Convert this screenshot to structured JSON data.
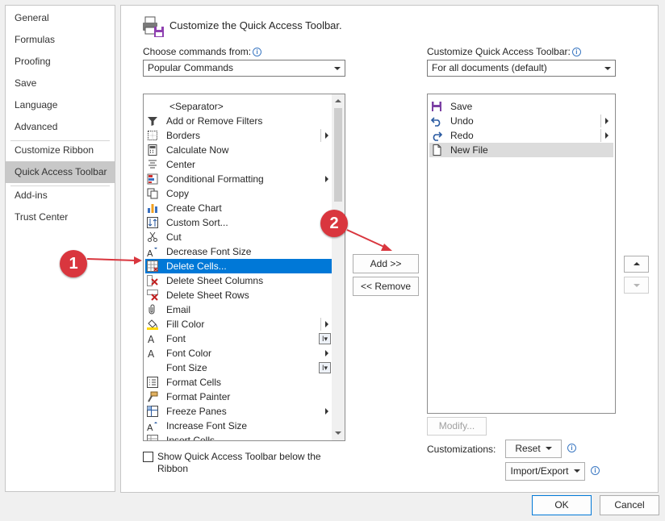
{
  "nav": {
    "items": [
      "General",
      "Formulas",
      "Proofing",
      "Save",
      "Language",
      "Advanced",
      "Customize Ribbon",
      "Quick Access Toolbar",
      "Add-ins",
      "Trust Center"
    ],
    "selected": "Quick Access Toolbar"
  },
  "header": {
    "title": "Customize the Quick Access Toolbar."
  },
  "left": {
    "label": "Choose commands from:",
    "source_value": "Popular Commands",
    "commands": [
      {
        "label": "<Separator>",
        "icon": "separator"
      },
      {
        "label": "Add or Remove Filters",
        "icon": "filter-icon"
      },
      {
        "label": "Borders",
        "icon": "borders-icon",
        "submenu": "box"
      },
      {
        "label": "Calculate Now",
        "icon": "calculator-icon"
      },
      {
        "label": "Center",
        "icon": "center-align-icon"
      },
      {
        "label": "Conditional Formatting",
        "icon": "conditional-formatting-icon",
        "submenu": "arrow"
      },
      {
        "label": "Copy",
        "icon": "copy-icon"
      },
      {
        "label": "Create Chart",
        "icon": "chart-icon"
      },
      {
        "label": "Custom Sort...",
        "icon": "sort-icon"
      },
      {
        "label": "Cut",
        "icon": "scissors-icon"
      },
      {
        "label": "Decrease Font Size",
        "icon": "decrease-font-icon"
      },
      {
        "label": "Delete Cells...",
        "icon": "delete-cells-icon",
        "selected": true
      },
      {
        "label": "Delete Sheet Columns",
        "icon": "delete-columns-icon"
      },
      {
        "label": "Delete Sheet Rows",
        "icon": "delete-rows-icon"
      },
      {
        "label": "Email",
        "icon": "email-icon"
      },
      {
        "label": "Fill Color",
        "icon": "fill-color-icon",
        "submenu": "box"
      },
      {
        "label": "Font",
        "icon": "font-icon",
        "submenu": "ibeam"
      },
      {
        "label": "Font Color",
        "icon": "font-color-icon",
        "submenu": "arrow"
      },
      {
        "label": "Font Size",
        "icon": "font-size-icon",
        "submenu": "ibeam"
      },
      {
        "label": "Format Cells",
        "icon": "format-cells-icon"
      },
      {
        "label": "Format Painter",
        "icon": "format-painter-icon"
      },
      {
        "label": "Freeze Panes",
        "icon": "freeze-panes-icon",
        "submenu": "arrow"
      },
      {
        "label": "Increase Font Size",
        "icon": "increase-font-icon"
      },
      {
        "label": "Insert Cells...",
        "icon": "insert-cells-icon"
      }
    ],
    "checkbox_label_line1": "Show Quick Access Toolbar below the",
    "checkbox_label_line2": "Ribbon"
  },
  "middle": {
    "add_label": "Add >>",
    "remove_label": "<< Remove"
  },
  "right": {
    "label": "Customize Quick Access Toolbar:",
    "scope_value": "For all documents (default)",
    "items": [
      {
        "label": "Save",
        "icon": "save-icon"
      },
      {
        "label": "Undo",
        "icon": "undo-icon",
        "submenu": "box"
      },
      {
        "label": "Redo",
        "icon": "redo-icon",
        "submenu": "box"
      },
      {
        "label": "New File",
        "icon": "new-file-icon",
        "highlighted": true
      }
    ],
    "modify_label": "Modify...",
    "customizations_label": "Customizations:",
    "reset_label": "Reset",
    "import_export_label": "Import/Export"
  },
  "footer": {
    "ok_label": "OK",
    "cancel_label": "Cancel"
  },
  "callouts": [
    "1",
    "2"
  ],
  "colors": {
    "accent": "#0078d7",
    "callout": "#d9363e",
    "selected_nav": "#c8c8c8"
  }
}
